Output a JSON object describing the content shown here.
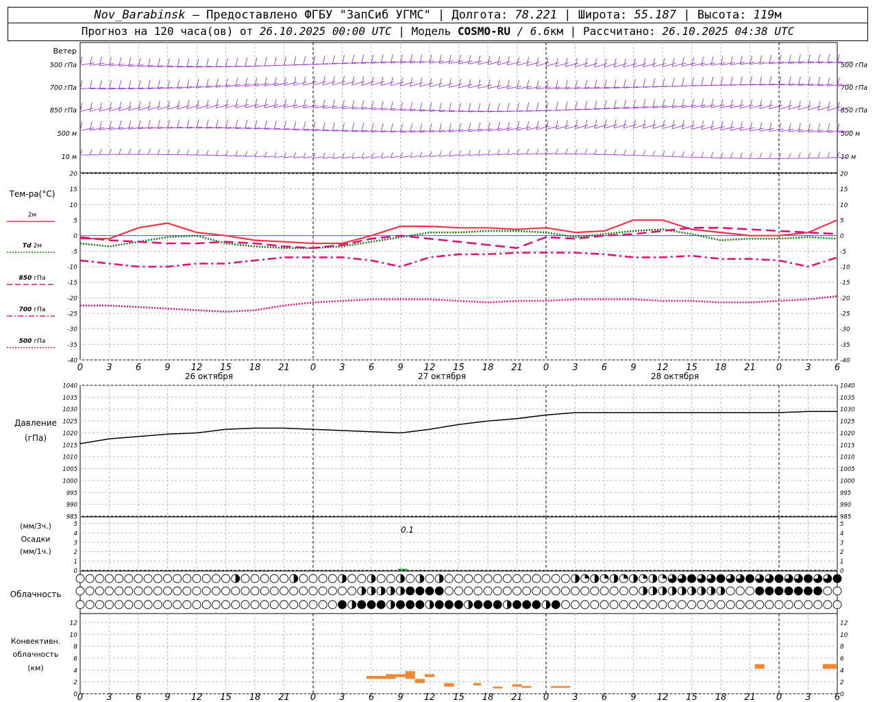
{
  "header": {
    "station": "Nov_Barabinsk",
    "provider": "— Предоставлено ФГБУ \"ЗапСиб УГМС\" |",
    "lon_label": "Долгота:",
    "lon_value": "78.221",
    "lat_label": "| Широта:",
    "lat_value": "55.187",
    "alt_label": "| Высота:",
    "alt_value": "119",
    "alt_unit": "м",
    "forecast_label": "Прогноз на 120 часа(ов) от",
    "forecast_time": "26.10.2025 00:00 UTC",
    "model_label": "| Модель",
    "model_name": "COSMO-RU",
    "model_res": "/ 6.6",
    "model_unit": "км",
    "computed_label": "| Рассчитано:",
    "computed_time": "26.10.2025 04:38 UTC"
  },
  "wind_panel": {
    "title": "Ветер",
    "levels": [
      "500 гПа",
      "700 гПа",
      "850 гПа",
      "500 м",
      "10 м"
    ],
    "barb_color": "#9933cc"
  },
  "temp_panel": {
    "title": "Тем-ра(°С)",
    "yticks": [
      20,
      15,
      10,
      5,
      0,
      -5,
      -10,
      -15,
      -20,
      -25,
      -30,
      -35,
      -40
    ],
    "ylim": [
      -40,
      20
    ],
    "legend": [
      {
        "label": "2м",
        "italic_prefix": "",
        "color": "#ee3344",
        "style": "solid"
      },
      {
        "label": "2м",
        "italic_prefix": "Td",
        "color": "#117711",
        "style": "dotted"
      },
      {
        "label": "гПа",
        "italic_prefix": "850",
        "color": "#dd1177",
        "style": "dashed"
      },
      {
        "label": "гПа",
        "italic_prefix": "700",
        "color": "#dd1177",
        "style": "dashdot"
      },
      {
        "label": "гПа",
        "italic_prefix": "500",
        "color": "#dd1177",
        "style": "dotted"
      }
    ]
  },
  "time_axis": {
    "hour_labels": [
      "0",
      "3",
      "6",
      "9",
      "12",
      "15",
      "18",
      "21",
      "0",
      "3",
      "6",
      "9",
      "12",
      "15",
      "18",
      "21",
      "0",
      "3",
      "6",
      "9",
      "12",
      "15",
      "18",
      "21",
      "0",
      "3",
      "6"
    ],
    "date_labels": [
      "26 октября",
      "27 октября",
      "28 октября"
    ]
  },
  "pressure_panel": {
    "title": "Давление",
    "unit": "(гПа)",
    "yticks": [
      1040,
      1035,
      1030,
      1025,
      1020,
      1015,
      1010,
      1005,
      1000,
      995,
      990,
      985
    ],
    "ylim": [
      985,
      1040
    ]
  },
  "precip_panel": {
    "unit_3h": "(мм/3ч.)",
    "title": "Осадки",
    "unit_1h": "(мм/1ч.)",
    "yticks": [
      5,
      4,
      3,
      2,
      1,
      0
    ],
    "annotation": "0.1"
  },
  "cloud_panel": {
    "title": "Облачность"
  },
  "conv_panel": {
    "title1": "Конвективн.",
    "title2": "облачность",
    "unit": "(км)",
    "yticks": [
      12,
      10,
      8,
      6,
      4,
      2,
      0
    ]
  },
  "chart_data": {
    "type": "line",
    "x_hours": [
      0,
      3,
      6,
      9,
      12,
      15,
      18,
      21,
      24,
      27,
      30,
      33,
      36,
      39,
      42,
      45,
      48,
      51,
      54,
      57,
      60,
      63,
      66,
      69,
      72,
      75,
      78
    ],
    "series": [
      {
        "name": "2м",
        "color": "#ee3344",
        "values": [
          -1,
          -1,
          2.5,
          4,
          1,
          0,
          -1.5,
          -2,
          -2.5,
          -2.5,
          0,
          3,
          3,
          2.5,
          2.5,
          2,
          2.5,
          1,
          1.5,
          5,
          5,
          2,
          1,
          0,
          0,
          1,
          5
        ]
      },
      {
        "name": "Td 2м",
        "color": "#117711",
        "values": [
          -2.5,
          -3.5,
          -2,
          -0.5,
          0,
          -2.5,
          -3.5,
          -4,
          -4,
          -3.5,
          -2,
          -0.5,
          1,
          1,
          1.5,
          1.5,
          1,
          -0.5,
          0.5,
          1.5,
          2,
          0.5,
          -1.5,
          -1,
          -1,
          -0.5,
          -1
        ]
      },
      {
        "name": "850 гПа",
        "color": "#dd1177",
        "values": [
          -0.5,
          -1.5,
          -2,
          -2.5,
          -2.5,
          -2,
          -2.5,
          -3.5,
          -4,
          -3,
          -1,
          0,
          -1,
          -2,
          -3,
          -4,
          -0.5,
          -1,
          0,
          0.5,
          1.5,
          2.5,
          2.5,
          2,
          1.5,
          1,
          0.5
        ]
      },
      {
        "name": "700 гПа",
        "color": "#dd1177",
        "values": [
          -8,
          -9,
          -10,
          -10,
          -9,
          -9,
          -8,
          -7,
          -7,
          -7,
          -8,
          -10,
          -7,
          -6,
          -6,
          -5.5,
          -5.5,
          -5.5,
          -6,
          -7,
          -7,
          -6.5,
          -7.5,
          -7.5,
          -8,
          -10,
          -7
        ]
      },
      {
        "name": "500 гПа",
        "color": "#dd1177",
        "values": [
          -22.5,
          -22.5,
          -23,
          -23.5,
          -24,
          -24.5,
          -24,
          -22.5,
          -21.5,
          -21,
          -20.5,
          -20.5,
          -20.5,
          -21,
          -21.5,
          -21,
          -21,
          -20.5,
          -20.5,
          -20.5,
          -21,
          -21,
          -21.5,
          -21.5,
          -21,
          -20.5,
          -19.5
        ]
      },
      {
        "name": "Давление",
        "color": "#000000",
        "values": [
          1015.5,
          1017.5,
          1018.5,
          1019.5,
          1020,
          1021.5,
          1022,
          1022,
          1021.5,
          1021,
          1020.5,
          1020,
          1021.5,
          1023.5,
          1025,
          1026,
          1027.5,
          1028.5,
          1028.5,
          1028.5,
          1028.5,
          1028.5,
          1028.5,
          1028.5,
          1028.5,
          1029,
          1029
        ]
      }
    ],
    "precipitation": [
      {
        "hour": 33,
        "value": 0.1
      }
    ],
    "cloud_rows": [
      {
        "layer": "upper",
        "cover": [
          0,
          0,
          0,
          0,
          0,
          0,
          0,
          0,
          0,
          0,
          0,
          0,
          0,
          0,
          0,
          0,
          0,
          0,
          0,
          0,
          0,
          0,
          0,
          0,
          0,
          0,
          0,
          0,
          0,
          0,
          0,
          0,
          0,
          0,
          0,
          0,
          0,
          0,
          0,
          0,
          0,
          0,
          0,
          0,
          0,
          0,
          0,
          0,
          0,
          0,
          0,
          0,
          0,
          0,
          0,
          0,
          0,
          0,
          0,
          0,
          0,
          0,
          0,
          0,
          0,
          0,
          0,
          0,
          0,
          0,
          0,
          0,
          0,
          0,
          0,
          0,
          0,
          0,
          0,
          0,
          0,
          0,
          0,
          0,
          0,
          0,
          0,
          0,
          0,
          0,
          0,
          0,
          0,
          0,
          0,
          0,
          0,
          0,
          0,
          0,
          0,
          0,
          0,
          0,
          0,
          0,
          0,
          0,
          0,
          0,
          0,
          0,
          0,
          0,
          0,
          0,
          0,
          0,
          0,
          0,
          0,
          0,
          0,
          0,
          0,
          0,
          0,
          0,
          0,
          0,
          0,
          0,
          0,
          0,
          0,
          0,
          0,
          0,
          0,
          0,
          0,
          0,
          0,
          0,
          0,
          0,
          0,
          0,
          0,
          0,
          0,
          0,
          0,
          0,
          0,
          0,
          0,
          0,
          0,
          0,
          0,
          0,
          0,
          0,
          0,
          0,
          0,
          0,
          0,
          0,
          0,
          0,
          0,
          0,
          0,
          0,
          0,
          0
        ]
      },
      {
        "layer": "middle",
        "cover": []
      },
      {
        "layer": "lower",
        "cover": []
      }
    ],
    "convective_bars": [
      {
        "h0": 29.5,
        "h1": 31.5,
        "base": 2.5,
        "top": 3
      },
      {
        "h0": 31.5,
        "h1": 32.5,
        "base": 2.5,
        "top": 3.3
      },
      {
        "h0": 32.5,
        "h1": 33.5,
        "base": 2.8,
        "top": 3.3
      },
      {
        "h0": 33.5,
        "h1": 34.5,
        "base": 2.5,
        "top": 3.8
      },
      {
        "h0": 34.5,
        "h1": 35.5,
        "base": 1.8,
        "top": 2.5
      },
      {
        "h0": 35.5,
        "h1": 36.5,
        "base": 2.8,
        "top": 3.3
      },
      {
        "h0": 37.5,
        "h1": 38.5,
        "base": 1.2,
        "top": 1.8
      },
      {
        "h0": 40.5,
        "h1": 41.3,
        "base": 1.4,
        "top": 1.8
      },
      {
        "h0": 42.5,
        "h1": 43.5,
        "base": 0.9,
        "top": 1.2
      },
      {
        "h0": 44.5,
        "h1": 45.5,
        "base": 1.2,
        "top": 1.6
      },
      {
        "h0": 45.5,
        "h1": 46.5,
        "base": 1.0,
        "top": 1.3
      },
      {
        "h0": 48.5,
        "h1": 50.5,
        "base": 1.0,
        "top": 1.3
      },
      {
        "h0": 69.5,
        "h1": 70.5,
        "base": 4.2,
        "top": 5.0
      },
      {
        "h0": 76.5,
        "h1": 78,
        "base": 4.2,
        "top": 5.0
      }
    ],
    "xlabel": "",
    "ylabel": ""
  }
}
